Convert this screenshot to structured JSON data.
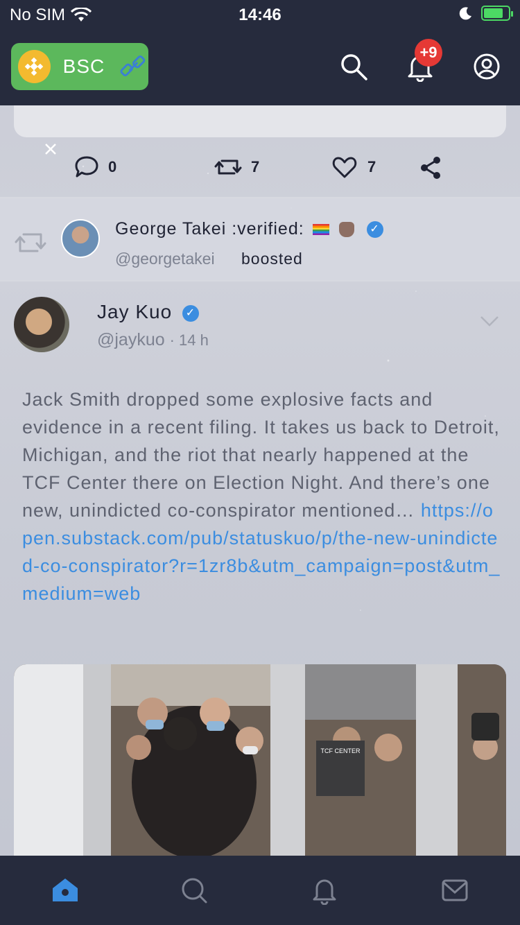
{
  "status_bar": {
    "carrier": "No SIM",
    "time": "14:46"
  },
  "header": {
    "network_label": "BSC",
    "notification_badge": "+9"
  },
  "prev_post_actions": {
    "replies": "0",
    "boosts": "7",
    "favourites": "7"
  },
  "boost_info": {
    "booster_name": "George Takei :verified:",
    "booster_handle": "@georgetakei",
    "boosted_label": "boosted"
  },
  "post": {
    "author_name": "Jay Kuo",
    "author_handle": "@jaykuo",
    "time_ago": "· 14 h",
    "text": "Jack Smith dropped some explosive facts and evidence in a recent filing. It takes us back to Detroit, Michigan, and the riot that nearly happened at the TCF Center there on Election Night. And there’s one new, unindicted co-conspirator mentioned… ",
    "link": "https://open.substack.com/pub/statuskuo/p/the-new-unindicted-co-conspirator?r=1zr8b&utm_campaign=post&utm_medium=web",
    "media_sign_text": "TCF CENTER"
  },
  "colors": {
    "header_bg": "#262b3d",
    "bsc_green": "#5cb85c",
    "accent_blue": "#3b8de0",
    "badge_red": "#e53935"
  }
}
